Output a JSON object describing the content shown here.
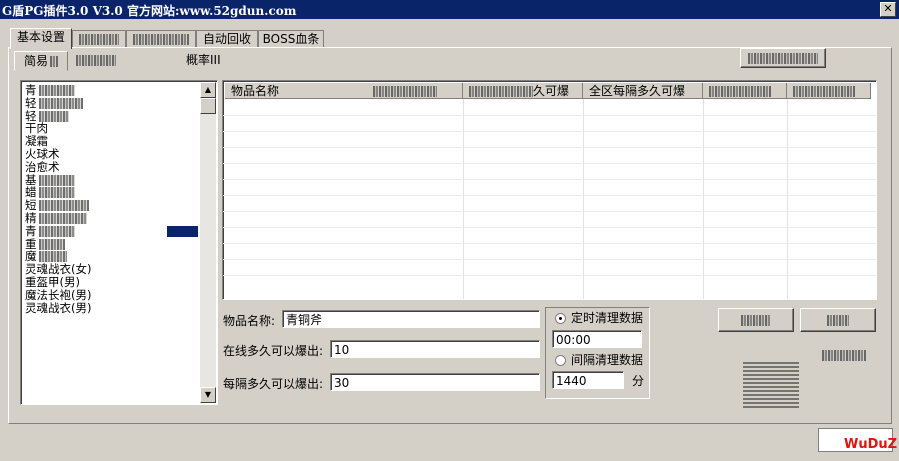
{
  "window": {
    "title": "G盾PG插件3.0 V3.0  官方网站:www.52gdun.com",
    "close_glyph": "✕"
  },
  "tabs": [
    "基本设置",
    "",
    "",
    "自动回收",
    "BOSS血条"
  ],
  "subtabs": {
    "active": "简易",
    "third": "概率III"
  },
  "item_list": {
    "items": [
      "青",
      "轻",
      "轻",
      "干肉",
      "凝霜",
      "火球术",
      "治愈术",
      "基",
      "蜡",
      "短",
      "精",
      "青",
      "重",
      "魔",
      "灵魂战衣(女)",
      "重盔甲(男)",
      "魔法长袍(男)",
      "灵魂战衣(男)"
    ],
    "selected_index": 11
  },
  "grid": {
    "columns": [
      "物品名称",
      "久可爆",
      "全区每隔多久可爆",
      "",
      ""
    ]
  },
  "form": {
    "item_name_label": "物品名称:",
    "item_name_value": "青铜斧",
    "online_label": "在线多久可以爆出:",
    "online_value": "10",
    "interval_label": "每隔多久可以爆出:",
    "interval_value": "30"
  },
  "clear_group": {
    "timed_label": "定时清理数据",
    "timed_value": "00:00",
    "interval_label": "间隔清理数据",
    "interval_value": "1440",
    "unit": "分"
  },
  "status": {
    "logo": "WuDuZ"
  },
  "colors": {
    "titlebar": "#0a246a",
    "face": "#d4d0c8",
    "selection": "#0a246a",
    "logo": "#e0140c"
  }
}
